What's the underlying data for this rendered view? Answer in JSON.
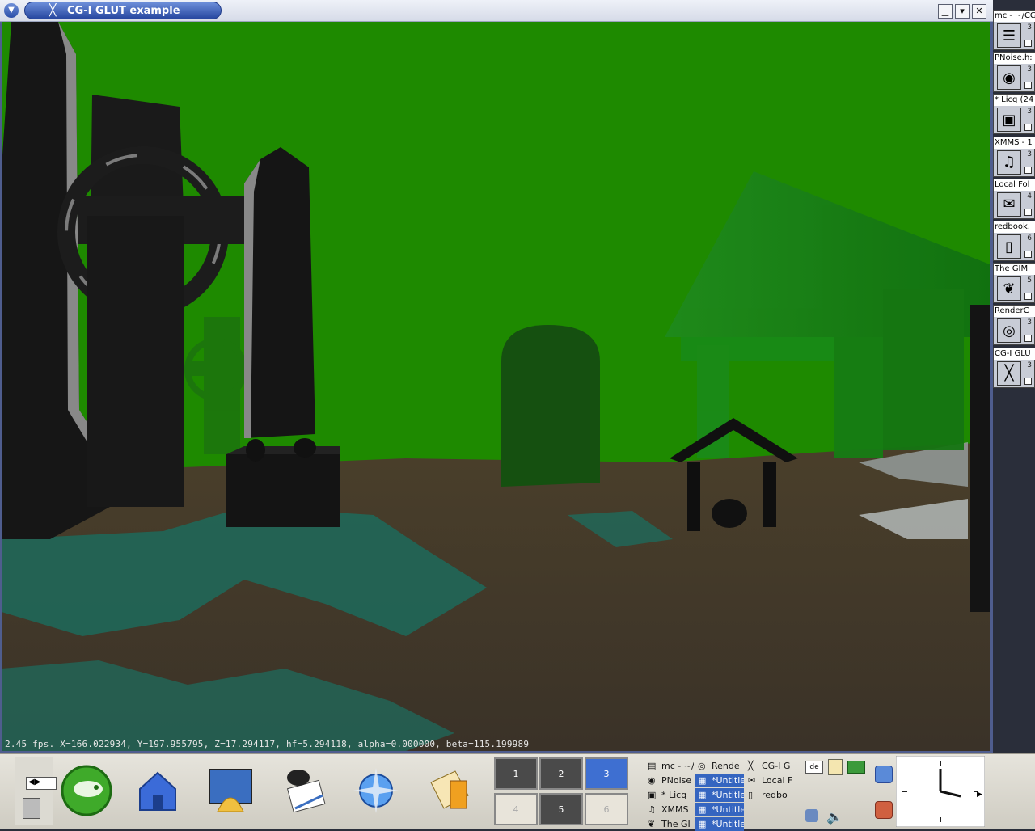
{
  "window": {
    "title": "CG-I GLUT example",
    "title_icon": "x-logo-icon",
    "controls": {
      "minimize": "▁",
      "maximize": "▾",
      "close": "✕"
    },
    "status_line": "2.45 fps.  X=166.022934, Y=197.955795, Z=17.294117, hf=5.294118, alpha=0.000000, beta=115.199989"
  },
  "pager": {
    "items": [
      {
        "title": "mc - ~/CG",
        "num": "3",
        "icon": "file-manager-icon"
      },
      {
        "title": "PNoise.h:",
        "num": "3",
        "icon": "browser-icon"
      },
      {
        "title": "* Licq (24",
        "num": "3",
        "icon": "computer-icon"
      },
      {
        "title": "XMMS - 1",
        "num": "3",
        "icon": "music-icon"
      },
      {
        "title": "Local Fol",
        "num": "4",
        "icon": "mail-icon"
      },
      {
        "title": "redbook.",
        "num": "6",
        "icon": "document-icon"
      },
      {
        "title": "The GIM",
        "num": "5",
        "icon": "gimp-icon"
      },
      {
        "title": "RenderC",
        "num": "3",
        "icon": "render-icon"
      },
      {
        "title": "CG-I GLU",
        "num": "3",
        "icon": "x-logo-icon"
      }
    ]
  },
  "panel": {
    "launchers": [
      {
        "name": "suse-launcher",
        "icon": "suse-chameleon-icon"
      },
      {
        "name": "home-launcher",
        "icon": "home-icon"
      },
      {
        "name": "control-center-launcher",
        "icon": "control-center-icon"
      },
      {
        "name": "editor-launcher",
        "icon": "editor-icon"
      },
      {
        "name": "konqueror-launcher",
        "icon": "konqueror-icon"
      },
      {
        "name": "kmail-launcher",
        "icon": "kmail-icon"
      }
    ],
    "desktops": [
      "1",
      "2",
      "3",
      "4",
      "5",
      "6"
    ],
    "active_desktop": "3",
    "tasks": [
      {
        "label": "mc - ~/",
        "icon": "terminal-icon"
      },
      {
        "label": "Rende",
        "icon": "render-icon"
      },
      {
        "label": "CG-I G",
        "icon": "x-logo-icon"
      },
      {
        "label": "PNoise",
        "icon": "browser-icon"
      },
      {
        "label": "*Untitle",
        "icon": "gimp-image-icon"
      },
      {
        "label": "Local F",
        "icon": "mail-icon"
      },
      {
        "label": "* Licq",
        "icon": "computer-icon"
      },
      {
        "label": "*Untitle",
        "icon": "gimp-image-icon"
      },
      {
        "label": "redbo",
        "icon": "document-icon"
      },
      {
        "label": "XMMS",
        "icon": "music-icon"
      },
      {
        "label": "*Untitle",
        "icon": "gimp-image-icon"
      },
      {
        "label": "The GI",
        "icon": "gimp-icon"
      },
      {
        "label": "*Untitle",
        "icon": "gimp-image-icon"
      }
    ],
    "tray": {
      "keyboard_layout": "de"
    },
    "colors": {
      "active_desktop": "#3e6fd1",
      "inactive_desktop": "#4a4a4a",
      "sky": "#1e8a00"
    }
  }
}
